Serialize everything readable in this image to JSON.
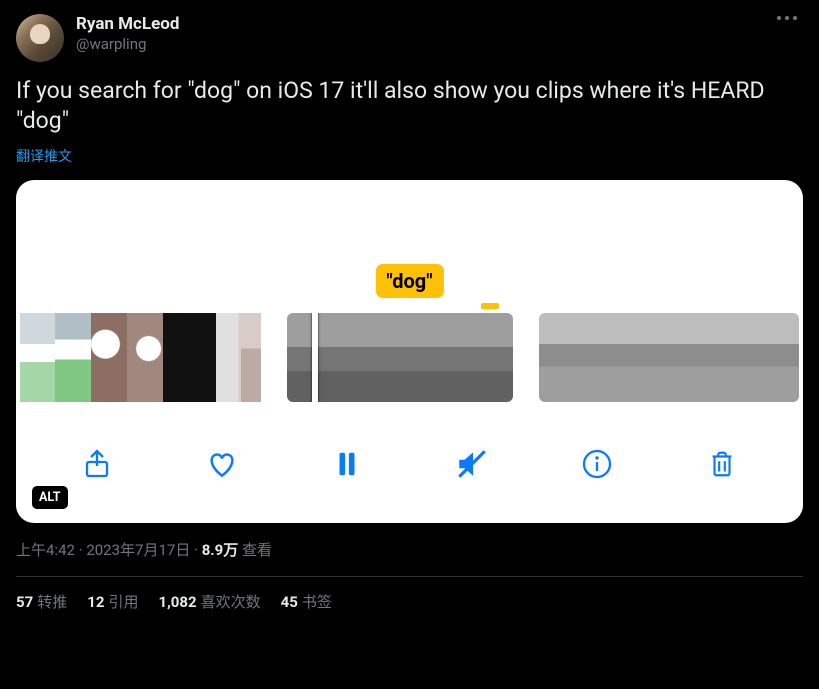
{
  "author": {
    "display_name": "Ryan McLeod",
    "handle": "@warpling"
  },
  "tweet_text": "If you search for \"dog\" on iOS 17 it'll also show you clips where it's HEARD \"dog\"",
  "translate_label": "翻译推文",
  "media": {
    "search_term_label": "\"dog\"",
    "alt_badge": "ALT",
    "controls": {
      "share": "share",
      "like": "like",
      "pause": "pause",
      "mute": "mute",
      "info": "info",
      "delete": "delete"
    }
  },
  "meta": {
    "time": "上午4:42",
    "date": "2023年7月17日",
    "views_value": "8.9万",
    "views_label": "查看",
    "separator": " · "
  },
  "stats": {
    "retweets_value": "57",
    "retweets_label": "转推",
    "quotes_value": "12",
    "quotes_label": "引用",
    "likes_value": "1,082",
    "likes_label": "喜欢次数",
    "bookmarks_value": "45",
    "bookmarks_label": "书签"
  }
}
